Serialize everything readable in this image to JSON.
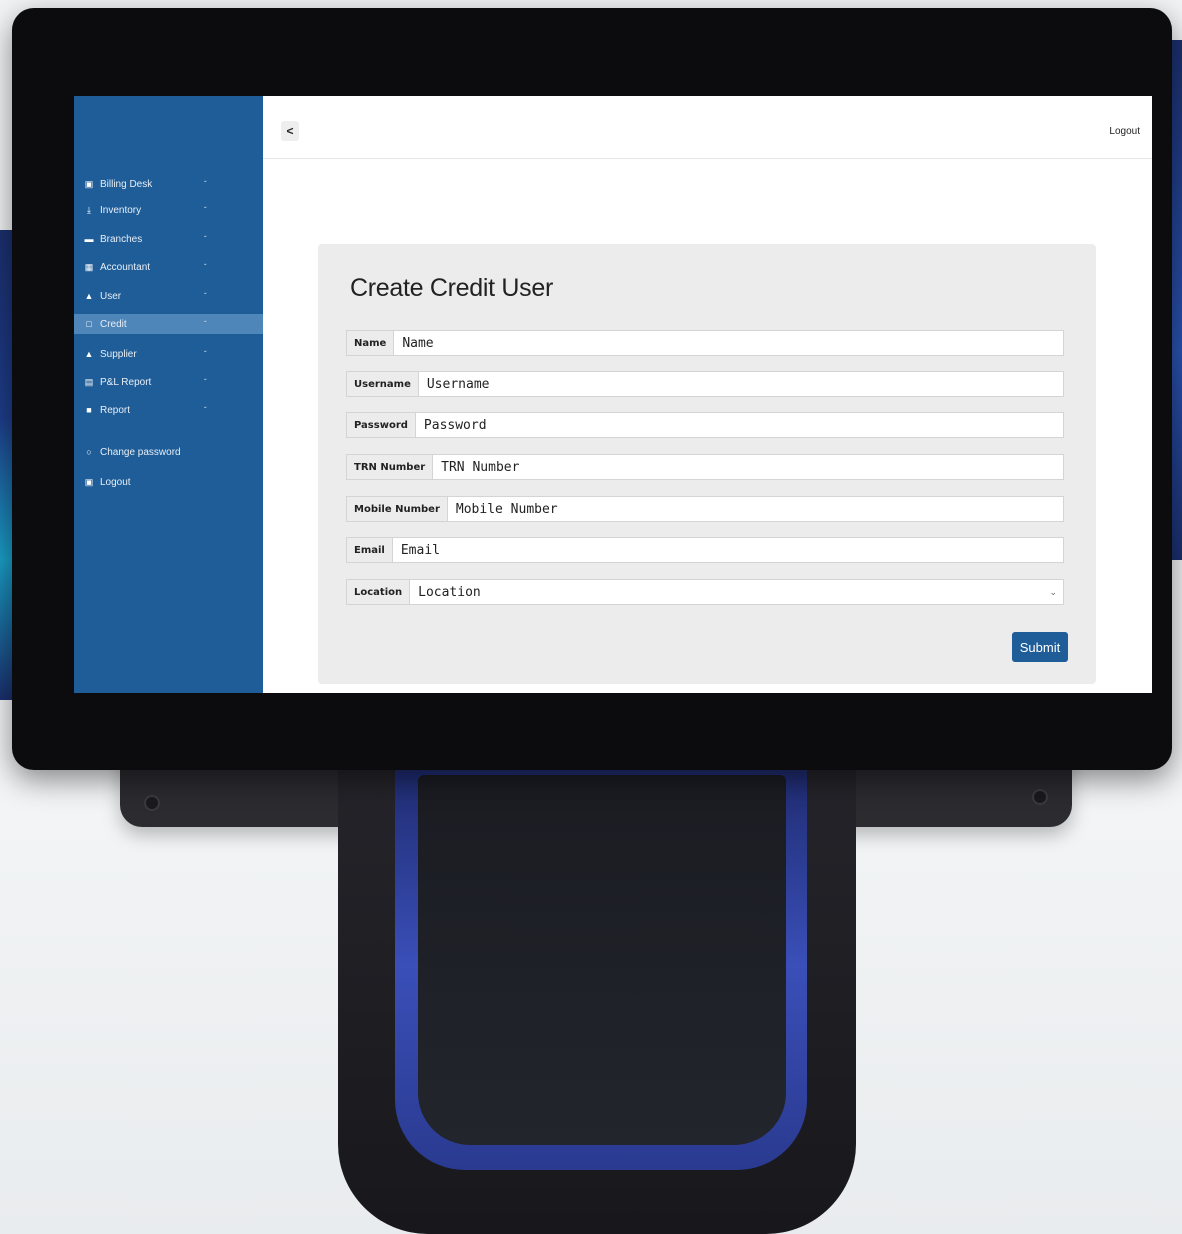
{
  "sidebar": {
    "items": [
      {
        "label": "Billing Desk",
        "icon": "billing-icon",
        "glyph": "▣",
        "chevron": "ˇ"
      },
      {
        "label": "Inventory",
        "icon": "inventory-icon",
        "glyph": "⤓",
        "chevron": "ˇ"
      },
      {
        "label": "Branches",
        "icon": "branches-icon",
        "glyph": "▬",
        "chevron": "ˇ"
      },
      {
        "label": "Accountant",
        "icon": "accountant-icon",
        "glyph": "▦",
        "chevron": "ˇ"
      },
      {
        "label": "User",
        "icon": "user-icon",
        "glyph": "▲",
        "chevron": "ˇ"
      },
      {
        "label": "Credit",
        "icon": "credit-icon",
        "glyph": "□",
        "chevron": "ˇ",
        "active": true
      },
      {
        "label": "Supplier",
        "icon": "supplier-icon",
        "glyph": "▲",
        "chevron": "ˇ"
      },
      {
        "label": "P&L Report",
        "icon": "pl-report-icon",
        "glyph": "▤",
        "chevron": "ˇ"
      },
      {
        "label": "Report",
        "icon": "report-icon",
        "glyph": "■",
        "chevron": "ˇ"
      }
    ],
    "change_password": {
      "label": "Change password",
      "icon": "circle-icon",
      "glyph": "○"
    },
    "logout": {
      "label": "Logout",
      "icon": "logout-icon",
      "glyph": "▣"
    }
  },
  "topbar": {
    "back_glyph": "<",
    "logout_label": "Logout"
  },
  "form": {
    "title": "Create Credit User",
    "fields": [
      {
        "label": "Name",
        "placeholder": "Name"
      },
      {
        "label": "Username",
        "placeholder": "Username"
      },
      {
        "label": "Password",
        "placeholder": "Password"
      },
      {
        "label": "TRN Number",
        "placeholder": "TRN Number"
      },
      {
        "label": "Mobile Number",
        "placeholder": "Mobile Number"
      },
      {
        "label": "Email",
        "placeholder": "Email"
      }
    ],
    "location": {
      "label": "Location",
      "value": "Location",
      "chevron": "⌄"
    },
    "submit_label": "Submit"
  },
  "colors": {
    "sidebar": "#1f5d98",
    "sidebar_active": "#4f86ba",
    "card": "#ececec",
    "submit": "#1f5d98"
  }
}
